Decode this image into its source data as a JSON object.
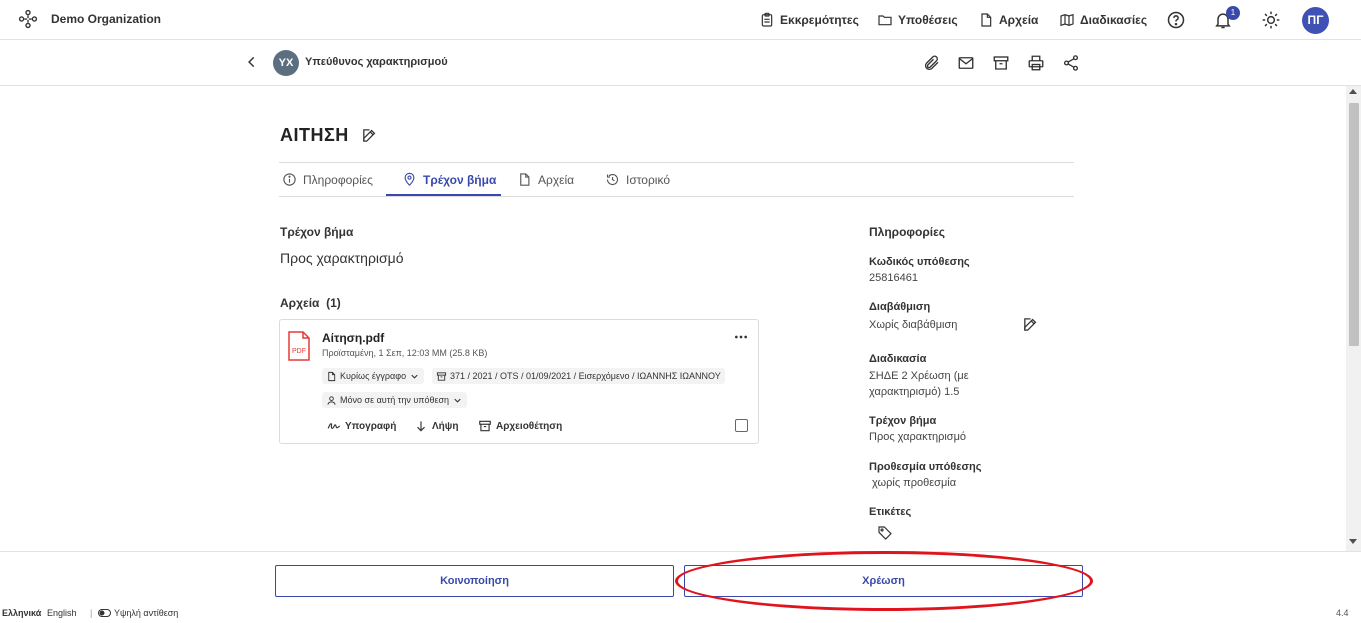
{
  "topbar": {
    "org_name": "Demo Organization",
    "nav": [
      {
        "label": "Εκκρεμότητες",
        "icon": "clipboard-icon"
      },
      {
        "label": "Υποθέσεις",
        "icon": "folder-icon"
      },
      {
        "label": "Αρχεία",
        "icon": "file-icon"
      },
      {
        "label": "Διαδικασίες",
        "icon": "map-icon"
      }
    ],
    "notification_count": "1",
    "user_initials": "ΠΓ"
  },
  "subbar": {
    "assignee_initials": "ΥΧ",
    "assignee_name": "Υπεύθυνος χαρακτηρισμού"
  },
  "case": {
    "title": "ΑΙΤΗΣΗ",
    "tabs": [
      {
        "label": "Πληροφορίες",
        "icon": "info-icon"
      },
      {
        "label": "Τρέχον βήμα",
        "icon": "location-pin-icon",
        "active": true
      },
      {
        "label": "Αρχεία",
        "icon": "file-icon"
      },
      {
        "label": "Ιστορικό",
        "icon": "history-icon"
      }
    ]
  },
  "current_step": {
    "heading": "Τρέχον βήμα",
    "value": "Προς χαρακτηρισμό"
  },
  "files": {
    "heading": "Αρχεία",
    "count": "(1)",
    "items": [
      {
        "name": "Αίτηση.pdf",
        "meta": "Προϊσταμένη,  1 Σεπ, 12:03 ΜΜ (25.8 KB)",
        "type_chip": "Κυρίως έγγραφο",
        "registry_chip": "371 / 2021 / OTS / 01/09/2021 / Εισερχόμενο / ΙΩΑΝΝΗΣ ΙΩΑΝΝΟΥ",
        "scope_chip": "Μόνο σε αυτή την υπόθεση",
        "actions": [
          "Υπογραφή",
          "Λήψη",
          "Αρχειοθέτηση"
        ],
        "file_type_label": "PDF"
      }
    ]
  },
  "info_panel": {
    "heading": "Πληροφορίες",
    "fields": [
      {
        "label": "Κωδικός υπόθεσης",
        "value": "25816461"
      },
      {
        "label": "Διαβάθμιση",
        "value": "Χωρίς διαβάθμιση"
      },
      {
        "label": "Διαδικασία",
        "value_line1": "ΣΗΔΕ 2 Χρέωση (με",
        "value_line2": "χαρακτηρισμό) 1.5"
      },
      {
        "label": "Τρέχον βήμα",
        "value": "Προς χαρακτηρισμό"
      },
      {
        "label": "Προθεσμία υπόθεσης",
        "value": " χωρίς προθεσμία"
      },
      {
        "label": "Ετικέτες"
      }
    ]
  },
  "actions": {
    "share_label": "Κοινοποίηση",
    "assign_label": "Χρέωση"
  },
  "footer": {
    "lang_greek": "Ελληνικά",
    "lang_english": "English",
    "high_contrast": "Υψηλή αντίθεση",
    "version": "4.4"
  },
  "colors": {
    "accent": "#3949ab",
    "highlight": "#e0141c",
    "pdf_red": "#e53935"
  }
}
